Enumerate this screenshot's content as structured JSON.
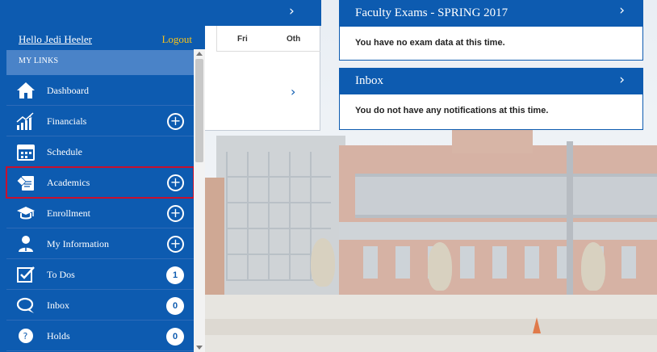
{
  "top_bar": {
    "chevron": "›"
  },
  "sidebar": {
    "greeting": "Hello Jedi Heeler",
    "logout": "Logout",
    "section_title": "MY LINKS",
    "items": [
      {
        "label": "Dashboard",
        "icon": "home-icon"
      },
      {
        "label": "Financials",
        "icon": "chart-icon",
        "expand": "+"
      },
      {
        "label": "Schedule",
        "icon": "calendar-icon"
      },
      {
        "label": "Academics",
        "icon": "academics-icon",
        "expand": "+"
      },
      {
        "label": "Enrollment",
        "icon": "graduation-cap-icon",
        "expand": "+"
      },
      {
        "label": "My Information",
        "icon": "person-icon",
        "expand": "+"
      },
      {
        "label": "To Dos",
        "icon": "checkbox-icon",
        "count": "1"
      },
      {
        "label": "Inbox",
        "icon": "chat-icon",
        "count": "0"
      },
      {
        "label": "Holds",
        "icon": "help-icon",
        "count": "0"
      }
    ]
  },
  "calendar": {
    "day1": "Fri",
    "day2": "Oth",
    "next": "›"
  },
  "panels": {
    "exams": {
      "title": "Faculty Exams - SPRING 2017",
      "chevron": "›",
      "message": "You have no exam data at this time."
    },
    "inbox": {
      "title": "Inbox",
      "chevron": "›",
      "message": "You do not have any notifications at this time."
    }
  },
  "colors": {
    "primary": "#0d5bb0",
    "section": "#4a83c8",
    "logout": "#f5c21b",
    "highlight": "#c8102e"
  }
}
